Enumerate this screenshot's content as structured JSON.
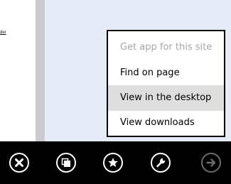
{
  "page": {
    "snippet_text": "der"
  },
  "context_menu": {
    "items": [
      {
        "label": "Get app for this site",
        "state": "disabled"
      },
      {
        "label": "Find on page",
        "state": "normal"
      },
      {
        "label": "View in the desktop",
        "state": "highlighted"
      },
      {
        "label": "View downloads",
        "state": "normal"
      }
    ]
  },
  "app_bar": {
    "buttons": [
      {
        "icon": "close-icon",
        "enabled": true
      },
      {
        "icon": "tabs-icon",
        "enabled": true
      },
      {
        "icon": "star-icon",
        "enabled": true
      },
      {
        "icon": "wrench-icon",
        "enabled": true
      },
      {
        "icon": "forward-arrow-icon",
        "enabled": false
      }
    ]
  },
  "colors": {
    "page_background": "#e6ebf8",
    "menu_highlight": "#dedede",
    "menu_disabled_text": "#a7a7a7",
    "app_bar_background": "#000000",
    "icon_enabled": "#ffffff",
    "icon_disabled": "#6a6a6a"
  }
}
